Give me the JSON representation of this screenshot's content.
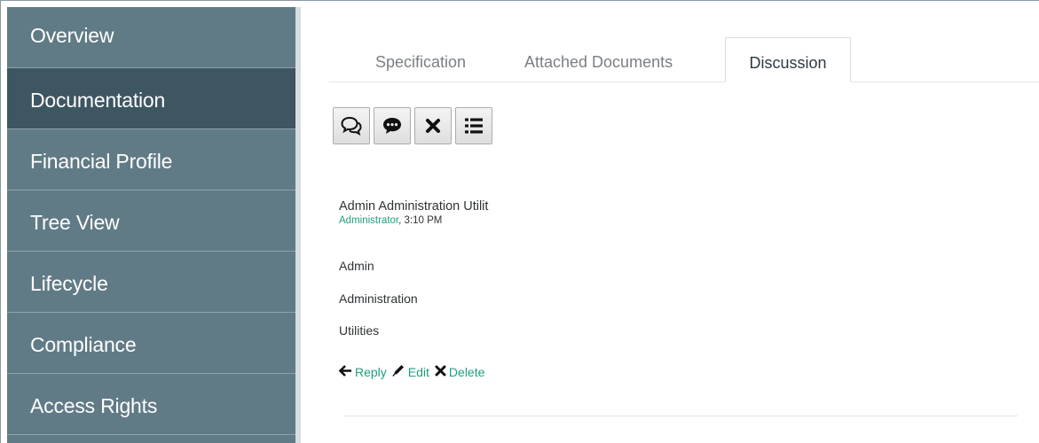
{
  "sidebar": {
    "items": [
      {
        "label": "Overview"
      },
      {
        "label": "Documentation",
        "active": true
      },
      {
        "label": "Financial Profile"
      },
      {
        "label": "Tree View"
      },
      {
        "label": "Lifecycle"
      },
      {
        "label": "Compliance"
      },
      {
        "label": "Access Rights"
      }
    ]
  },
  "tabs": [
    {
      "label": "Specification"
    },
    {
      "label": "Attached Documents"
    },
    {
      "label": "Discussion",
      "active": true
    }
  ],
  "toolbar": {
    "buttons": [
      {
        "icon": "comments-icon"
      },
      {
        "icon": "comment-dots-icon"
      },
      {
        "icon": "close-icon"
      },
      {
        "icon": "list-icon"
      }
    ]
  },
  "comment": {
    "author": "Admin Administration Utilit",
    "role": "Administrator",
    "time": ", 3:10 PM",
    "lines": [
      "Admin",
      "Administration",
      "Utilities"
    ],
    "actions": {
      "reply": "Reply",
      "edit": "Edit",
      "delete": "Delete"
    }
  },
  "colors": {
    "sidebar_bg": "#617b86",
    "sidebar_active": "#3e5562",
    "accent_green": "#1e9e80"
  }
}
